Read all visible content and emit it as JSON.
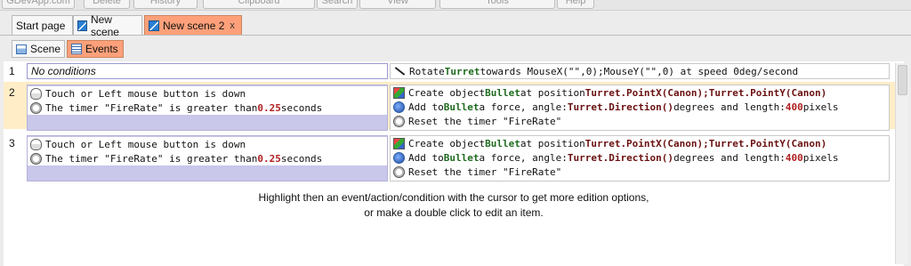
{
  "ribbon": {
    "items": [
      "GDevApp.com",
      "Delete",
      "History",
      "Clipboard",
      "Search",
      "View",
      "Tools",
      "Help"
    ]
  },
  "doc_tabs": [
    {
      "label": "Start page"
    },
    {
      "label": "New scene"
    },
    {
      "label": "New scene 2",
      "close": "x"
    }
  ],
  "sub_tabs": [
    {
      "label": "Scene"
    },
    {
      "label": "Events"
    }
  ],
  "events": [
    {
      "number": "1",
      "conditions_placeholder": "No conditions",
      "action": {
        "pre": "Rotate ",
        "obj": "Turret",
        "mid": " towards MouseX(\"\",0);MouseY(\"\",0) at speed 0deg/second"
      }
    },
    {
      "number": "2",
      "cond1": "Touch or Left mouse button is down",
      "cond2": {
        "pre": "The timer \"FireRate\" is greater than ",
        "val": "0.25",
        "post": " seconds"
      },
      "act1": {
        "pre": "Create object ",
        "obj": "Bullet",
        "mid": " at position ",
        "expr": "Turret.PointX(Canon);Turret.PointY(Canon)"
      },
      "act2": {
        "pre": "Add to ",
        "obj": "Bullet",
        "mid": " a force, angle: ",
        "expr": "Turret.Direction()",
        "mid2": " degrees and length: ",
        "val": "400",
        "post": " pixels"
      },
      "act3": "Reset the timer \"FireRate\""
    },
    {
      "number": "3",
      "cond1": "Touch or Left mouse button is down",
      "cond2": {
        "pre": "The timer \"FireRate\" is greater than ",
        "val": "0.25",
        "post": " seconds"
      },
      "act1": {
        "pre": "Create object ",
        "obj": "Bullet",
        "mid": " at position ",
        "expr": "Turret.PointX(Canon);Turret.PointY(Canon)"
      },
      "act2": {
        "pre": "Add to ",
        "obj": "Bullet",
        "mid": " a force, angle: ",
        "expr": "Turret.Direction()",
        "mid2": " degrees and length: ",
        "val": "400",
        "post": " pixels"
      },
      "act3": "Reset the timer \"FireRate\""
    }
  ],
  "hint": {
    "line1": "Highlight then an event/action/condition with the cursor to get more edition options,",
    "line2": "or make a double click to edit an item."
  },
  "colors": {
    "active_tab": "#ffa07a",
    "condition_bg": "#c9c7ea",
    "selected_event": "#ffedc7",
    "object": "#1f6b1f",
    "expression": "#6b1010"
  }
}
